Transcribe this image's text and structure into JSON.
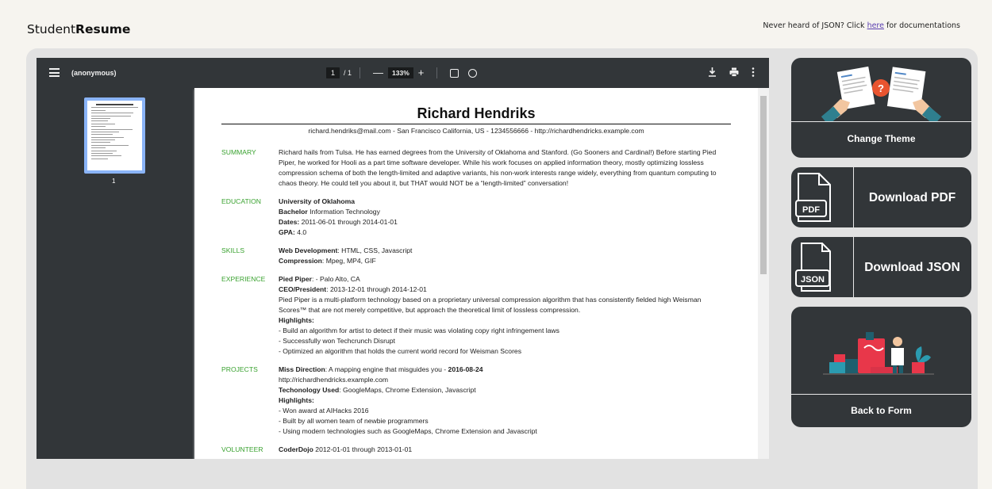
{
  "header": {
    "brand_prefix": "Student",
    "brand_bold": "Resume",
    "json_note_pre": "Never heard of JSON? Click ",
    "json_note_link": "here",
    "json_note_post": " for documentations"
  },
  "viewer": {
    "title": "(anonymous)",
    "page_current": "1",
    "page_total": "/ 1",
    "zoom_minus": "—",
    "zoom": "133%",
    "zoom_plus": "+",
    "thumb_number": "1"
  },
  "resume": {
    "name": "Richard Hendriks",
    "contact": "richard.hendriks@mail.com  -  San Francisco California, US  -  1234556666  -  http://richardhendricks.example.com",
    "summary_label": "SUMMARY",
    "summary": "Richard hails from Tulsa. He has earned degrees from the University of Oklahoma and Stanford. (Go Sooners and Cardinal!) Before starting Pied Piper, he worked for Hooli as a part time software developer. While his work focuses on applied information theory, mostly optimizing lossless compression schema of both the length-limited and adaptive variants, his non-work interests range widely, everything from quantum computing to chaos theory. He could tell you about it, but THAT would NOT be a “length-limited” conversation!",
    "education_label": "EDUCATION",
    "edu_school": "University of Oklahoma",
    "edu_degree_label": "Bachelor",
    "edu_degree": " Information Technology",
    "edu_dates_label": "Dates:",
    "edu_dates": " 2011-06-01 through 2014-01-01",
    "edu_gpa_label": "GPA:",
    "edu_gpa": " 4.0",
    "skills_label": "SKILLS",
    "skill1_name": "Web Development",
    "skill1_value": ": HTML, CSS, Javascript",
    "skill2_name": "Compression",
    "skill2_value": ": Mpeg, MP4, GIF",
    "experience_label": "EXPERIENCE",
    "exp_company": "Pied Piper",
    "exp_location": ": - Palo Alto, CA",
    "exp_role": "CEO/President",
    "exp_dates": ": 2013-12-01 through 2014-12-01",
    "exp_desc": "Pied Piper is a multi-platform technology based on a proprietary universal compression algorithm that has consistently fielded high Weisman Scores™ that are not merely competitive, but approach the theoretical limit of lossless compression.",
    "exp_highlights_label": "Highlights:",
    "exp_h1": "- Build an algorithm for artist to detect if their music was violating copy right infringement laws",
    "exp_h2": "- Successfully won Techcrunch Disrupt",
    "exp_h3": "- Optimized an algorithm that holds the current world record for Weisman Scores",
    "projects_label": "PROJECTS",
    "proj_name": "Miss Direction",
    "proj_desc": ": A mapping engine that misguides you - ",
    "proj_date": "2016-08-24",
    "proj_url": "http://richardhendricks.example.com",
    "proj_tech_label": "Techonology Used",
    "proj_tech": ": GoogleMaps, Chrome Extension, Javascript",
    "proj_highlights_label": "Highlights:",
    "proj_h1": "- Won award at AIHacks 2016",
    "proj_h2": "- Built by all women team of newbie programmers",
    "proj_h3": "- Using modern technologies such as GoogleMaps, Chrome Extension and Javascript",
    "volunteer_label": "VOLUNTEER",
    "vol_org": "CoderDojo",
    "vol_dates": " 2012-01-01 through 2013-01-01"
  },
  "actions": {
    "change_theme": "Change Theme",
    "download_pdf": "Download PDF",
    "pdf_icon_text": "PDF",
    "download_json": "Download JSON",
    "json_icon_text": "JSON",
    "back_to_form": "Back to Form"
  },
  "colors": {
    "section_label": "#3aa230",
    "card_bg": "#323639",
    "viewer_toolbar": "#323639",
    "link": "#5b3fb0"
  },
  "icons": [
    "menu-icon",
    "fit-page-icon",
    "rotate-icon",
    "download-icon",
    "print-icon",
    "more-vert-icon",
    "pdf-file-icon",
    "json-file-icon"
  ]
}
